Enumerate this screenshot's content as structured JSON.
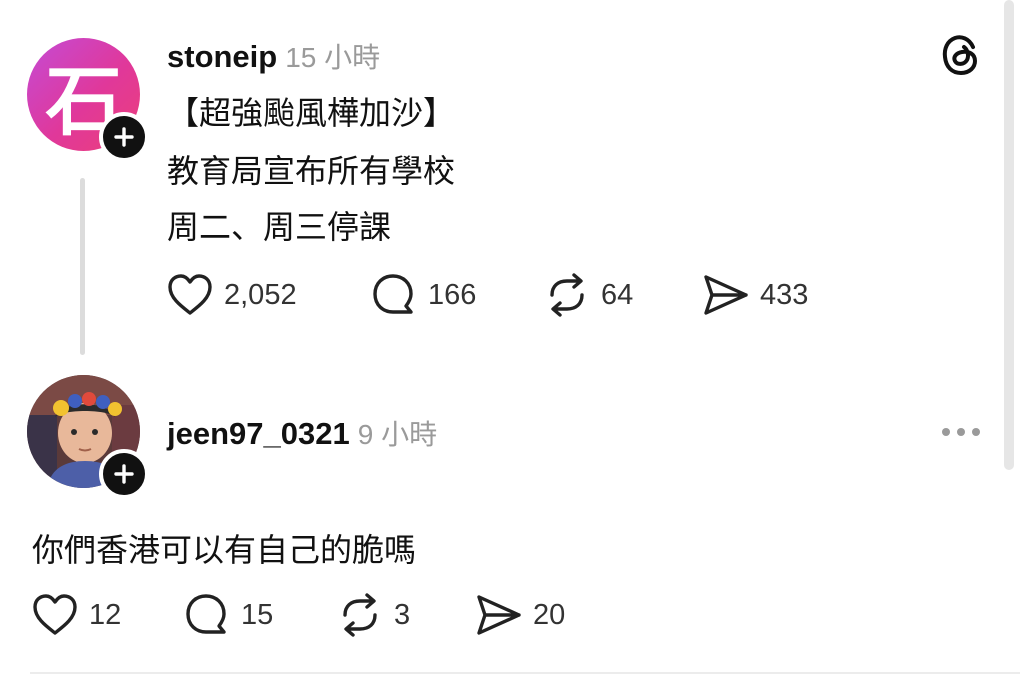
{
  "post": {
    "avatar_glyph": "石",
    "username": "stoneip",
    "time": "15 小時",
    "lines": [
      "【超強颱風樺加沙】",
      "教育局宣布所有學校",
      "周二、周三停課"
    ],
    "actions": {
      "likes": "2,052",
      "comments": "166",
      "reposts": "64",
      "shares": "433"
    }
  },
  "reply": {
    "username": "jeen97_0321",
    "time": "9 小時",
    "text": "你們香港可以有自己的脆嗎",
    "actions": {
      "likes": "12",
      "comments": "15",
      "reposts": "3",
      "shares": "20"
    }
  },
  "icons": {
    "app_logo": "threads-logo-icon",
    "more": "more-horizontal-icon",
    "like": "heart-icon",
    "comment": "comment-bubble-icon",
    "repost": "repost-icon",
    "share": "send-icon",
    "follow": "plus-icon"
  },
  "colors": {
    "avatar_gradient_start": "#c44bd6",
    "avatar_gradient_end": "#ec3f7a",
    "text": "#111111",
    "muted": "#9a9a9a"
  }
}
